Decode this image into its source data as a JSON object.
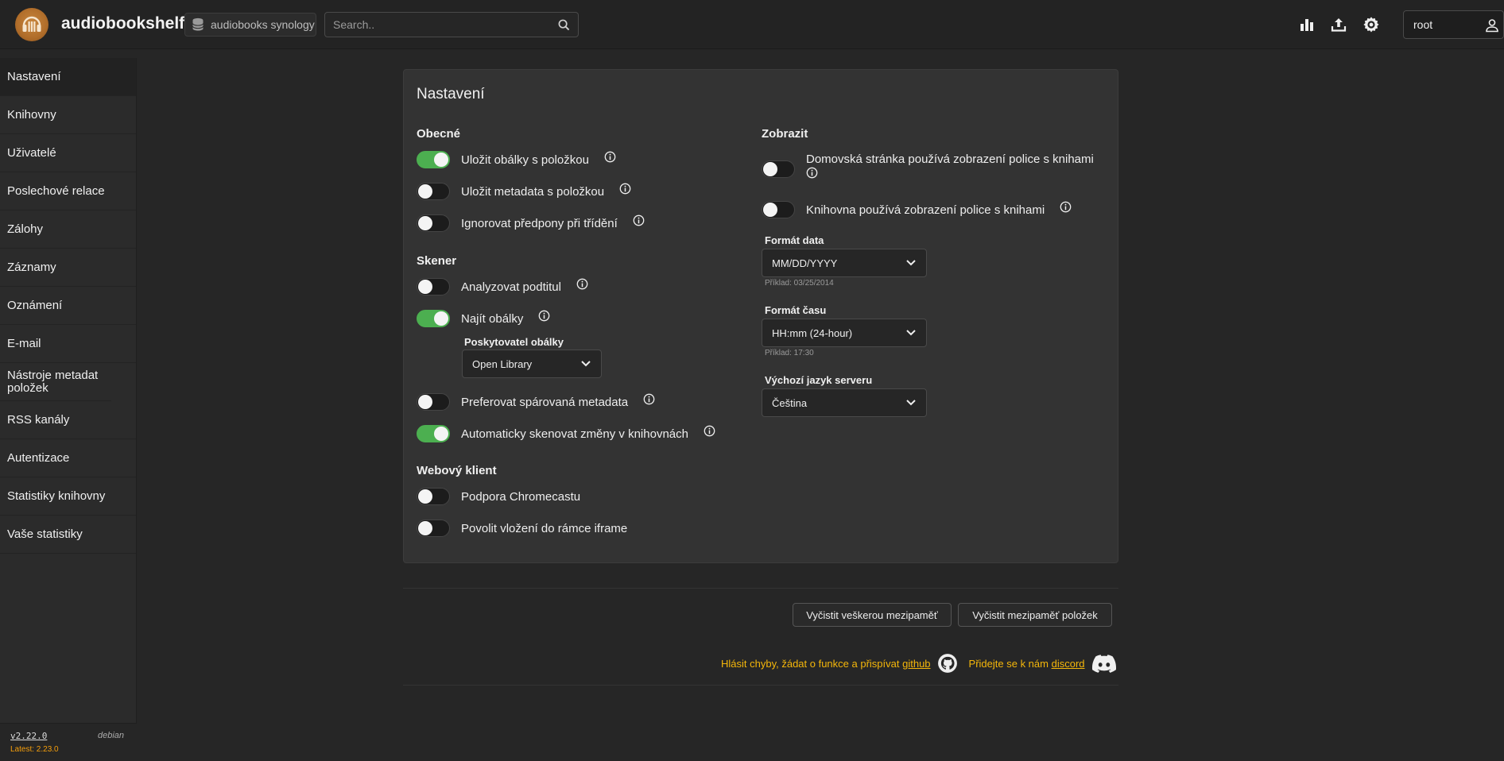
{
  "header": {
    "app_title": "audiobookshelf",
    "library_name": "audiobooks synology",
    "search_placeholder": "Search..",
    "username": "root"
  },
  "sidebar": {
    "items": [
      {
        "label": "Nastavení",
        "active": true
      },
      {
        "label": "Knihovny"
      },
      {
        "label": "Uživatelé"
      },
      {
        "label": "Poslechové relace"
      },
      {
        "label": "Zálohy"
      },
      {
        "label": "Záznamy"
      },
      {
        "label": "Oznámení"
      },
      {
        "label": "E-mail"
      },
      {
        "label": "Nástroje metadat položek"
      },
      {
        "label": "RSS kanály"
      },
      {
        "label": "Autentizace"
      },
      {
        "label": "Statistiky knihovny"
      },
      {
        "label": "Vaše statistiky"
      }
    ],
    "version": "v2.22.0",
    "os": "debian",
    "latest": "Latest: 2.23.0"
  },
  "settings": {
    "title": "Nastavení",
    "general": {
      "title": "Obecné",
      "store_covers": {
        "label": "Uložit obálky s položkou",
        "on": true
      },
      "store_metadata": {
        "label": "Uložit metadata s položkou",
        "on": false
      },
      "ignore_prefixes": {
        "label": "Ignorovat předpony při třídění",
        "on": false
      }
    },
    "scanner": {
      "title": "Skener",
      "parse_subtitle": {
        "label": "Analyzovat podtitul",
        "on": false
      },
      "find_covers": {
        "label": "Najít obálky",
        "on": true
      },
      "cover_provider_label": "Poskytovatel obálky",
      "cover_provider_value": "Open Library",
      "prefer_matched": {
        "label": "Preferovat spárovaná metadata",
        "on": false
      },
      "auto_scan": {
        "label": "Automaticky skenovat změny v knihovnách",
        "on": true
      }
    },
    "web_client": {
      "title": "Webový klient",
      "chromecast": {
        "label": "Podpora Chromecastu",
        "on": false
      },
      "iframe": {
        "label": "Povolit vložení do rámce iframe",
        "on": false
      }
    },
    "display": {
      "title": "Zobrazit",
      "home_shelf": {
        "label_line1": "Domovská stránka používá zobrazení police s knihami",
        "on": false
      },
      "library_shelf": {
        "label": "Knihovna používá zobrazení police s knihami",
        "on": false
      },
      "date_format_label": "Formát data",
      "date_format_value": "MM/DD/YYYY",
      "date_example": "Příklad: 03/25/2014",
      "time_format_label": "Formát času",
      "time_format_value": "HH:mm (24-hour)",
      "time_example": "Příklad: 17:30",
      "language_label": "Výchozí jazyk serveru",
      "language_value": "Čeština"
    }
  },
  "actions": {
    "purge_all_cache": "Vyčistit veškerou mezipaměť",
    "purge_items_cache": "Vyčistit mezipaměť položek"
  },
  "footer": {
    "report_text": "Hlásit chyby, žádat o funkce a přispívat",
    "github_link": "github",
    "discord_text": "Přidejte se k nám",
    "discord_link": "discord"
  },
  "colors": {
    "toggle_on": "#4caf50",
    "link_accent": "#f5b70a",
    "latest_version": "#f59e0b"
  }
}
